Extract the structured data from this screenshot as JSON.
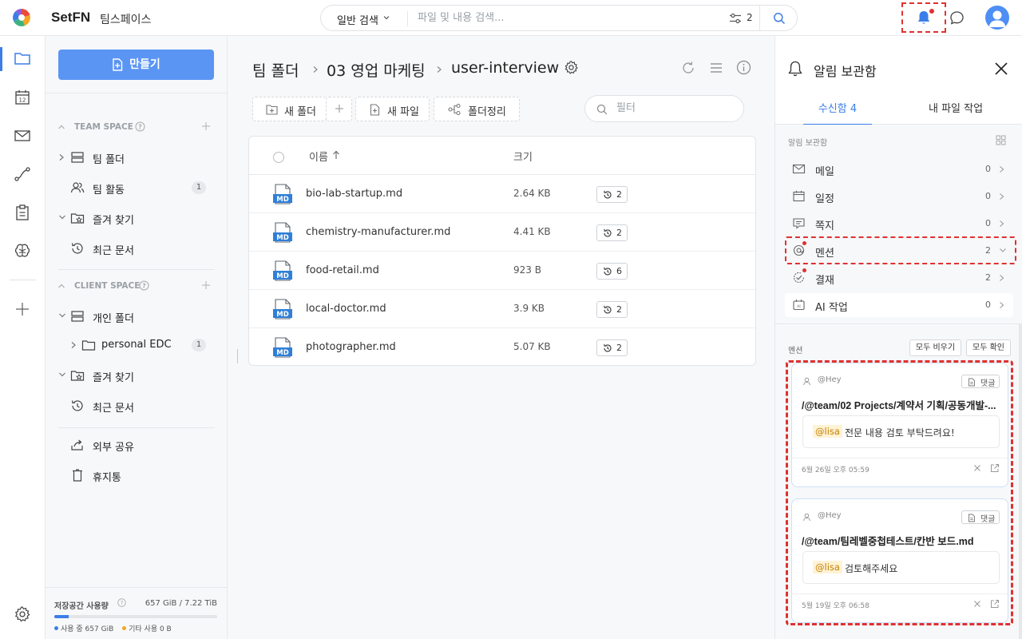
{
  "topbar": {
    "brand": "SetFN",
    "workspace": "팀스페이스",
    "search": {
      "type_label": "일반 검색",
      "placeholder": "파일 및 내용 검색...",
      "filter_count": "2"
    },
    "colors": {
      "accent": "#3b7ee8",
      "alert": "#e03131"
    }
  },
  "rail": {
    "items": [
      "folder-icon",
      "calendar-icon",
      "mail-icon",
      "workflow-icon",
      "clipboard-icon",
      "brain-icon",
      "plus-icon",
      "settings-icon"
    ],
    "calendar_day": "12"
  },
  "sidebar": {
    "make_label": "만들기",
    "team_space": {
      "header": "TEAM SPACE",
      "items": [
        {
          "label": "팀 폴더"
        },
        {
          "label": "팀 활동",
          "badge": "1"
        },
        {
          "label": "즐겨 찾기"
        },
        {
          "label": "최근 문서"
        }
      ]
    },
    "client_space": {
      "header": "CLIENT SPACE",
      "items": [
        {
          "label": "개인 폴더"
        },
        {
          "label": "personal EDC",
          "badge": "1"
        },
        {
          "label": "즐겨 찾기"
        },
        {
          "label": "최근 문서"
        }
      ]
    },
    "extra": [
      {
        "label": "외부 공유"
      },
      {
        "label": "휴지통"
      }
    ],
    "storage": {
      "label": "저장공간 사용량",
      "value": "657 GiB / 7.22 TiB",
      "used_fraction": 0.089,
      "legend_used": "사용 중 657 GiB",
      "legend_other": "기타 사용 0 B",
      "used_color": "#3b7ee8",
      "other_color": "#f5a524"
    }
  },
  "main": {
    "breadcrumb": [
      "팀 폴더",
      "03 영업 마케팅",
      "user-interview"
    ],
    "toolbar": {
      "new_folder": "새 폴더",
      "new_file": "새 파일",
      "organize": "폴더정리"
    },
    "filter_placeholder": "필터",
    "table": {
      "columns": {
        "name": "이름",
        "size": "크기"
      },
      "rows": [
        {
          "type": "MD",
          "name": "bio-lab-startup.md",
          "size": "2.64 KB",
          "versions": "2"
        },
        {
          "type": "MD",
          "name": "chemistry-manufacturer.md",
          "size": "4.41 KB",
          "versions": "2"
        },
        {
          "type": "MD",
          "name": "food-retail.md",
          "size": "923 B",
          "versions": "6"
        },
        {
          "type": "MD",
          "name": "local-doctor.md",
          "size": "3.9 KB",
          "versions": "2"
        },
        {
          "type": "MD",
          "name": "photographer.md",
          "size": "5.07 KB",
          "versions": "2"
        }
      ]
    }
  },
  "panel": {
    "title": "알림 보관함",
    "tabs": [
      "수신함 4",
      "내 파일 작업"
    ],
    "categories_header": "알림 보관함",
    "categories": [
      {
        "icon": "mail-icon",
        "label": "메일",
        "count": "0"
      },
      {
        "icon": "calendar-icon",
        "label": "일정",
        "count": "0"
      },
      {
        "icon": "note-icon",
        "label": "쪽지",
        "count": "0"
      },
      {
        "icon": "at-icon",
        "label": "멘션",
        "count": "2"
      },
      {
        "icon": "approval-icon",
        "label": "결재",
        "count": "2"
      },
      {
        "icon": "ai-icon",
        "label": "AI 작업",
        "count": "0"
      }
    ],
    "mentions_header": "멘션",
    "clear_all": "모두 비우기",
    "check_all": "모두 확인",
    "mentions": [
      {
        "author": "@Hey",
        "tag": "댓글",
        "path": "/@team/02 Projects/계약서 기획/공동개발-...",
        "mention": "@lisa",
        "message": "전문 내용 검토 부탁드려요!",
        "time": "6월 26일 오후 05:59"
      },
      {
        "author": "@Hey",
        "tag": "댓글",
        "path": "/@team/팀레벨중첩테스트/칸반 보드.md",
        "mention": "@lisa",
        "message": "검토해주세요",
        "time": "5월 19일 오후 06:58"
      }
    ]
  }
}
